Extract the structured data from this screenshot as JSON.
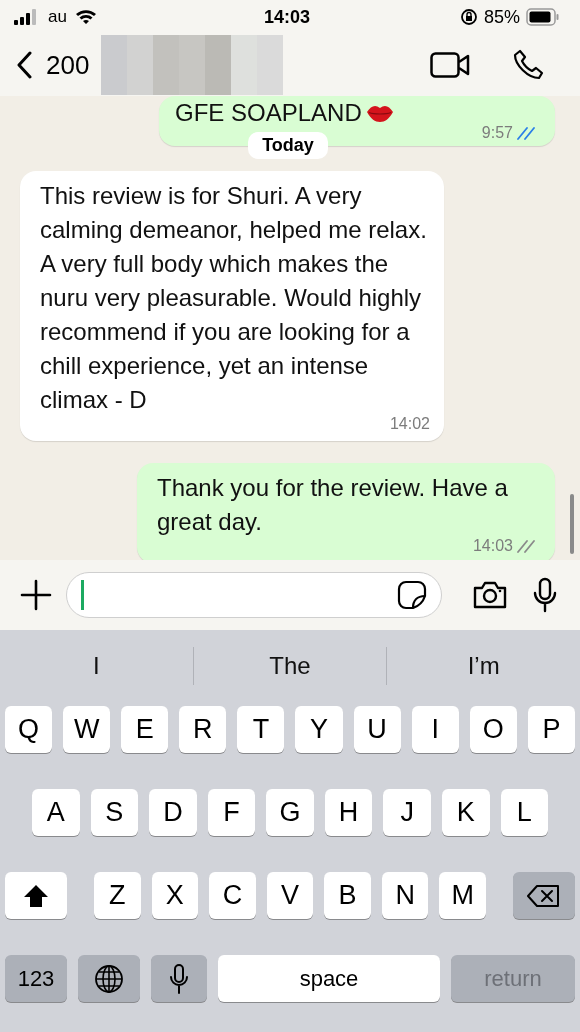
{
  "status_bar": {
    "carrier": "au",
    "time": "14:03",
    "battery": "85%"
  },
  "header": {
    "contact": "200"
  },
  "messages": [
    {
      "kind": "partial",
      "outgoing": true,
      "text": "GFE SOAPLAND",
      "time": "9:57",
      "read": true
    },
    {
      "kind": "date",
      "text": "Today"
    },
    {
      "kind": "text",
      "outgoing": false,
      "text": "This review is for Shuri. A very calming demeanor, helped me relax. A very full body which makes the nuru very pleasurable. Would highly recommend if you are looking for a chill experience, yet an intense climax - D",
      "time": "14:02"
    },
    {
      "kind": "text",
      "outgoing": true,
      "text": "Thank you for the review. Have a great day.",
      "time": "14:03",
      "read": false
    }
  ],
  "suggestions": [
    "I",
    "The",
    "I’m"
  ],
  "keyboard": {
    "rows": [
      [
        "Q",
        "W",
        "E",
        "R",
        "T",
        "Y",
        "U",
        "I",
        "O",
        "P"
      ],
      [
        "A",
        "S",
        "D",
        "F",
        "G",
        "H",
        "J",
        "K",
        "L"
      ],
      [
        "Z",
        "X",
        "C",
        "V",
        "B",
        "N",
        "M"
      ]
    ],
    "numbers_key": "123",
    "space_key": "space",
    "return_key": {
      "label": "return",
      "disabled": true
    }
  }
}
